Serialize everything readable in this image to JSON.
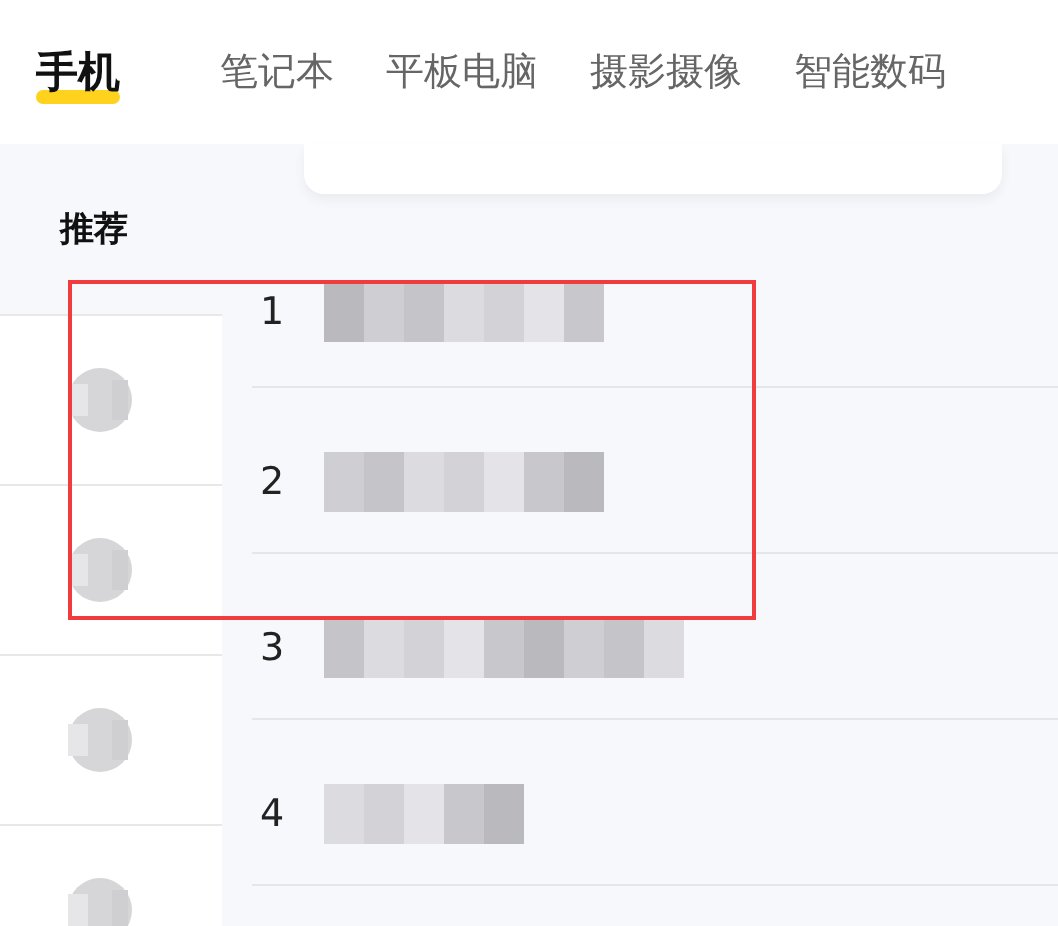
{
  "tabs": [
    {
      "label": "手机",
      "selected": true
    },
    {
      "label": "笔记本",
      "selected": false
    },
    {
      "label": "平板电脑",
      "selected": false
    },
    {
      "label": "摄影摄像",
      "selected": false
    },
    {
      "label": "智能数码",
      "selected": false
    }
  ],
  "sidebar": {
    "heading": "推荐",
    "items": [
      {
        "kind": "redacted"
      },
      {
        "kind": "redacted"
      },
      {
        "kind": "redacted"
      },
      {
        "kind": "redacted"
      }
    ]
  },
  "ranking": [
    {
      "rank": "1",
      "kind": "redacted"
    },
    {
      "rank": "2",
      "kind": "redacted"
    },
    {
      "rank": "3",
      "kind": "redacted"
    },
    {
      "rank": "4",
      "kind": "redacted"
    }
  ],
  "highlight": {
    "kind": "frame"
  }
}
